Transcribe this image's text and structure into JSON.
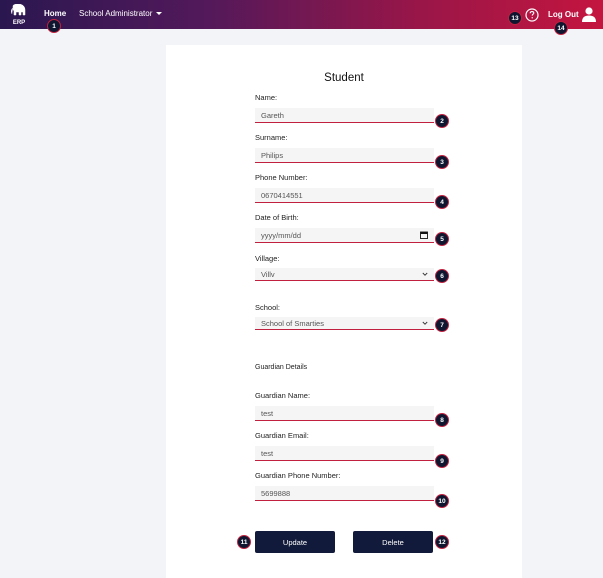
{
  "nav": {
    "logo_text": "ERP",
    "home": "Home",
    "role": "School Administrator",
    "logout": "Log Out"
  },
  "form": {
    "title": "Student",
    "name": {
      "label": "Name:",
      "value": "Gareth"
    },
    "surname": {
      "label": "Surname:",
      "value": "Philips"
    },
    "phone": {
      "label": "Phone Number:",
      "value": "0670414551"
    },
    "dob": {
      "label": "Date of Birth:",
      "placeholder": "yyyy/mm/dd"
    },
    "village": {
      "label": "Village:",
      "value": "Villv"
    },
    "school": {
      "label": "School:",
      "value": "School of Smarties"
    },
    "guardian_section": "Guardian Details",
    "guardian_name": {
      "label": "Guardian Name:",
      "value": "test"
    },
    "guardian_email": {
      "label": "Guardian Email:",
      "value": "test"
    },
    "guardian_phone": {
      "label": "Guardian Phone Number:",
      "value": "5699888"
    },
    "update_label": "Update",
    "delete_label": "Delete"
  },
  "badges": [
    "1",
    "2",
    "3",
    "4",
    "5",
    "6",
    "7",
    "8",
    "9",
    "10",
    "11",
    "12",
    "13",
    "14"
  ],
  "colors": {
    "nav_gradient_start": "#2a1750",
    "nav_gradient_end": "#c4153f",
    "accent": "#c2203f",
    "button": "#121a3b"
  },
  "icons": {
    "logo": "elephant-icon",
    "help": "question-circle-icon",
    "user": "user-icon",
    "calendar": "calendar-icon",
    "chevron": "chevron-down-icon"
  }
}
